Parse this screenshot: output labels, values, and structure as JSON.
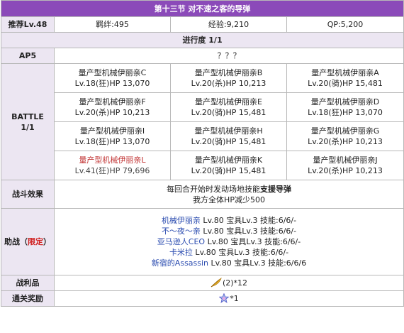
{
  "header": {
    "title": "第十三节 对不速之客的导弹"
  },
  "info": {
    "recommend": "推荐Lv.48",
    "bond": "羁绊:495",
    "exp": "经验:9,210",
    "qp": "QP:5,200"
  },
  "progress": "进行度 1/1",
  "ap": {
    "label": "AP5",
    "value": "？？？"
  },
  "battle": {
    "label_line1": "BATTLE",
    "label_line2": "1/1",
    "enemies": [
      {
        "name": "量产型机械伊丽亲C",
        "stat": "Lv.18(狂)HP 13,070"
      },
      {
        "name": "量产型机械伊丽亲B",
        "stat": "Lv.20(杀)HP 10,213"
      },
      {
        "name": "量产型机械伊丽亲A",
        "stat": "Lv.20(骑)HP 15,481"
      },
      {
        "name": "量产型机械伊丽亲F",
        "stat": "Lv.20(杀)HP 10,213"
      },
      {
        "name": "量产型机械伊丽亲E",
        "stat": "Lv.20(骑)HP 15,481"
      },
      {
        "name": "量产型机械伊丽亲D",
        "stat": "Lv.18(狂)HP 13,070"
      },
      {
        "name": "量产型机械伊丽亲I",
        "stat": "Lv.18(狂)HP 13,070"
      },
      {
        "name": "量产型机械伊丽亲H",
        "stat": "Lv.20(骑)HP 15,481"
      },
      {
        "name": "量产型机械伊丽亲G",
        "stat": "Lv.20(杀)HP 10,213"
      },
      {
        "name": "量产型机械伊丽亲L",
        "stat": "Lv.41(狂)HP 79,696"
      },
      {
        "name": "量产型机械伊丽亲K",
        "stat": "Lv.20(骑)HP 15,481"
      },
      {
        "name": "量产型机械伊丽亲J",
        "stat": "Lv.20(杀)HP 10,213"
      }
    ]
  },
  "effect": {
    "label": "战斗效果",
    "line1_a": "每回合开始时发动场地技能",
    "line1_b": "支援导弹",
    "line2": "我方全体HP减少500"
  },
  "support": {
    "label_a": "助战（",
    "label_b": "限定",
    "label_c": "）",
    "items": [
      {
        "name": "机械伊丽亲",
        "detail": " Lv.80 宝具Lv.3 技能:6/6/-"
      },
      {
        "name": "不～夜～亲",
        "detail": " Lv.80 宝具Lv.3 技能:6/6/-"
      },
      {
        "name": "亚马逊人CEO",
        "detail": " Lv.80 宝具Lv.3 技能:6/6/-"
      },
      {
        "name": "卡米拉",
        "detail": " Lv.80 宝具Lv.3 技能:6/6/-"
      },
      {
        "name": "新宿的Assassin",
        "detail": " Lv.80 宝具Lv.3 技能:6/6/6"
      }
    ]
  },
  "loot": {
    "label": "战利品",
    "icon": "feather-icon",
    "text": "(2)*12"
  },
  "reward": {
    "label": "通关奖励",
    "icon": "saint-quartz-icon",
    "text": "*1"
  },
  "colors": {
    "title_bg": "#8b4ab9",
    "header_bg": "#ece6f2",
    "link": "#2b4cb0",
    "highlight": "#d02020",
    "boss_name": "#c23535"
  }
}
